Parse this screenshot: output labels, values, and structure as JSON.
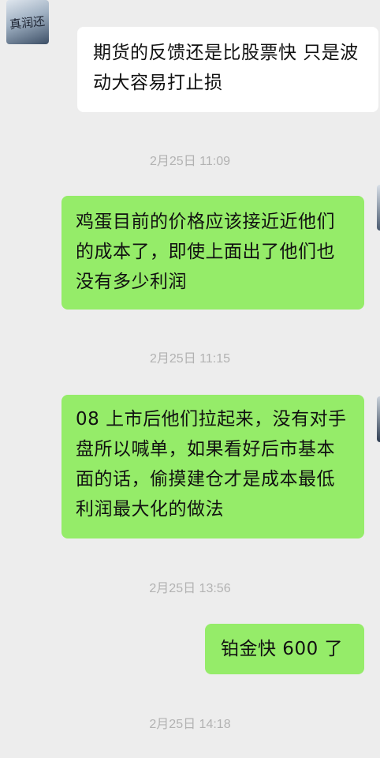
{
  "messages": [
    {
      "id": "m1",
      "side": "in",
      "text": "期货的反馈还是比股票快 只是波动大容易打止损"
    },
    {
      "id": "m2",
      "side": "out",
      "text": "鸡蛋目前的价格应该接近近他们的成本了，即使上面出了他们也没有多少利润"
    },
    {
      "id": "m3",
      "side": "out",
      "text": "08 上市后他们拉起来，没有对手盘所以喊单，如果看好后市基本面的话，偷摸建仓才是成本最低利润最大化的做法"
    },
    {
      "id": "m4",
      "side": "out",
      "text": "铂金快 600 了"
    }
  ],
  "timestamps": [
    "2月25日 11:09",
    "2月25日 11:15",
    "2月25日 13:56",
    "2月25日 14:18"
  ],
  "avatar_text": "真润还",
  "colors": {
    "background": "#ededed",
    "incoming_bubble": "#ffffff",
    "outgoing_bubble": "#95ec69",
    "timestamp": "#b2b2b2"
  }
}
